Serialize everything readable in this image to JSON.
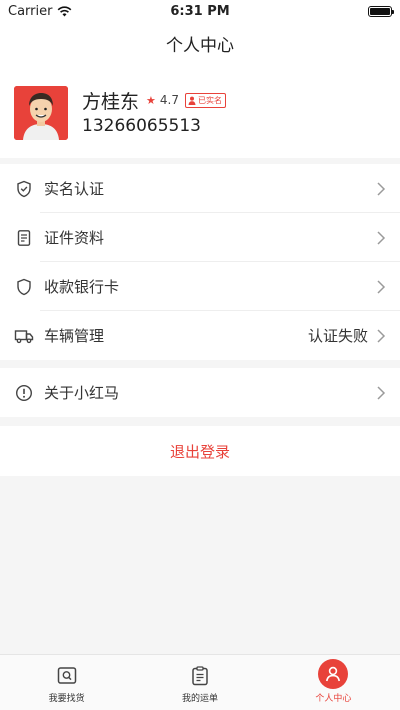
{
  "status_bar": {
    "carrier": "Carrier",
    "time": "6:31 PM"
  },
  "header": {
    "title": "个人中心"
  },
  "profile": {
    "name": "方桂东",
    "rating": "4.7",
    "verified_badge": "已实名",
    "phone": "13266065513"
  },
  "menu": {
    "items": [
      {
        "label": "实名认证",
        "icon": "shield-check-icon"
      },
      {
        "label": "证件资料",
        "icon": "document-icon"
      },
      {
        "label": "收款银行卡",
        "icon": "shield-icon"
      },
      {
        "label": "车辆管理",
        "icon": "truck-icon",
        "value": "认证失败"
      },
      {
        "label": "关于小红马",
        "icon": "info-icon"
      }
    ]
  },
  "logout": {
    "label": "退出登录"
  },
  "tabbar": {
    "tabs": [
      {
        "label": "我要找货",
        "icon": "search-goods-icon"
      },
      {
        "label": "我的运单",
        "icon": "clipboard-icon"
      },
      {
        "label": "个人中心",
        "icon": "person-icon",
        "active": true
      }
    ]
  },
  "colors": {
    "accent": "#e8423a",
    "background": "#f5f5f5"
  }
}
